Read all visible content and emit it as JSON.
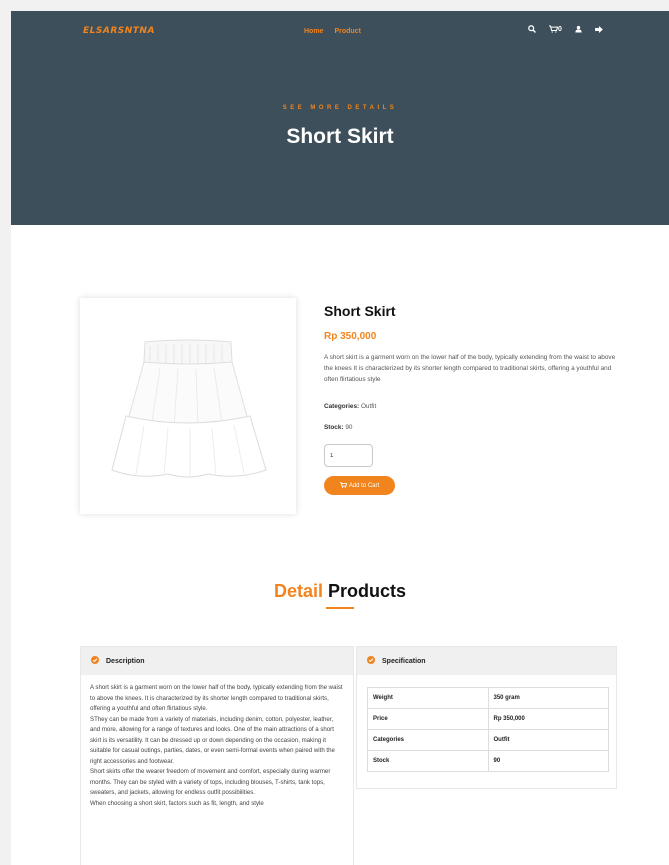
{
  "header": {
    "logo": "ELSARSNTNA",
    "nav": [
      "Home",
      "Product"
    ],
    "cart_count": "0"
  },
  "hero": {
    "subtitle": "SEE MORE DETAILS",
    "title": "Short Skirt"
  },
  "product": {
    "name": "Short Skirt",
    "price": "Rp 350,000",
    "description": "A short skirt is a garment worn on the lower half of the body, typically extending from the waist to above the knees It is characterized by its shorter length compared to traditional skirts, offering a youthful and often flirtatious style",
    "categories_label": "Categories:",
    "categories_value": "Outfit",
    "stock_label": "Stock:",
    "stock_value": "90",
    "quantity": "1",
    "add_to_cart_label": "Add to Cart"
  },
  "details": {
    "title_accent": "Detail",
    "title_rest": "Products",
    "description_heading": "Description",
    "description_paragraphs": [
      "A short skirt is a garment worn on the lower half of the body, typically extending from the waist to above the knees. It is characterized by its shorter length compared to traditional skirts, offering a youthful and often flirtatious style.",
      "SThey can be made from a variety of materials, including denim, cotton, polyester, leather, and more, allowing for a range of textures and looks. One of the main attractions of a short skirt is its versatility. It can be dressed up or down depending on the occasion, making it suitable for casual outings, parties, dates, or even semi-formal events when paired with the right accessories and footwear.",
      "Short skirts offer the wearer freedom of movement and comfort, especially during warmer months. They can be styled with a variety of tops, including blouses, T-shirts, tank tops, sweaters, and jackets, allowing for endless outfit possibilities.",
      "When choosing a short skirt, factors such as fit, length, and style"
    ],
    "specification_heading": "Specification",
    "specification_rows": [
      {
        "label": "Weight",
        "value": "350 gram"
      },
      {
        "label": "Price",
        "value": "Rp 350,000"
      },
      {
        "label": "Categories",
        "value": "Outfit"
      },
      {
        "label": "Stock",
        "value": "90"
      }
    ]
  },
  "colors": {
    "accent": "#f2841e",
    "hero_bg": "#3d4f5a"
  },
  "icons": [
    "search-icon",
    "cart-icon",
    "user-icon",
    "logout-icon",
    "check-circle-icon"
  ]
}
